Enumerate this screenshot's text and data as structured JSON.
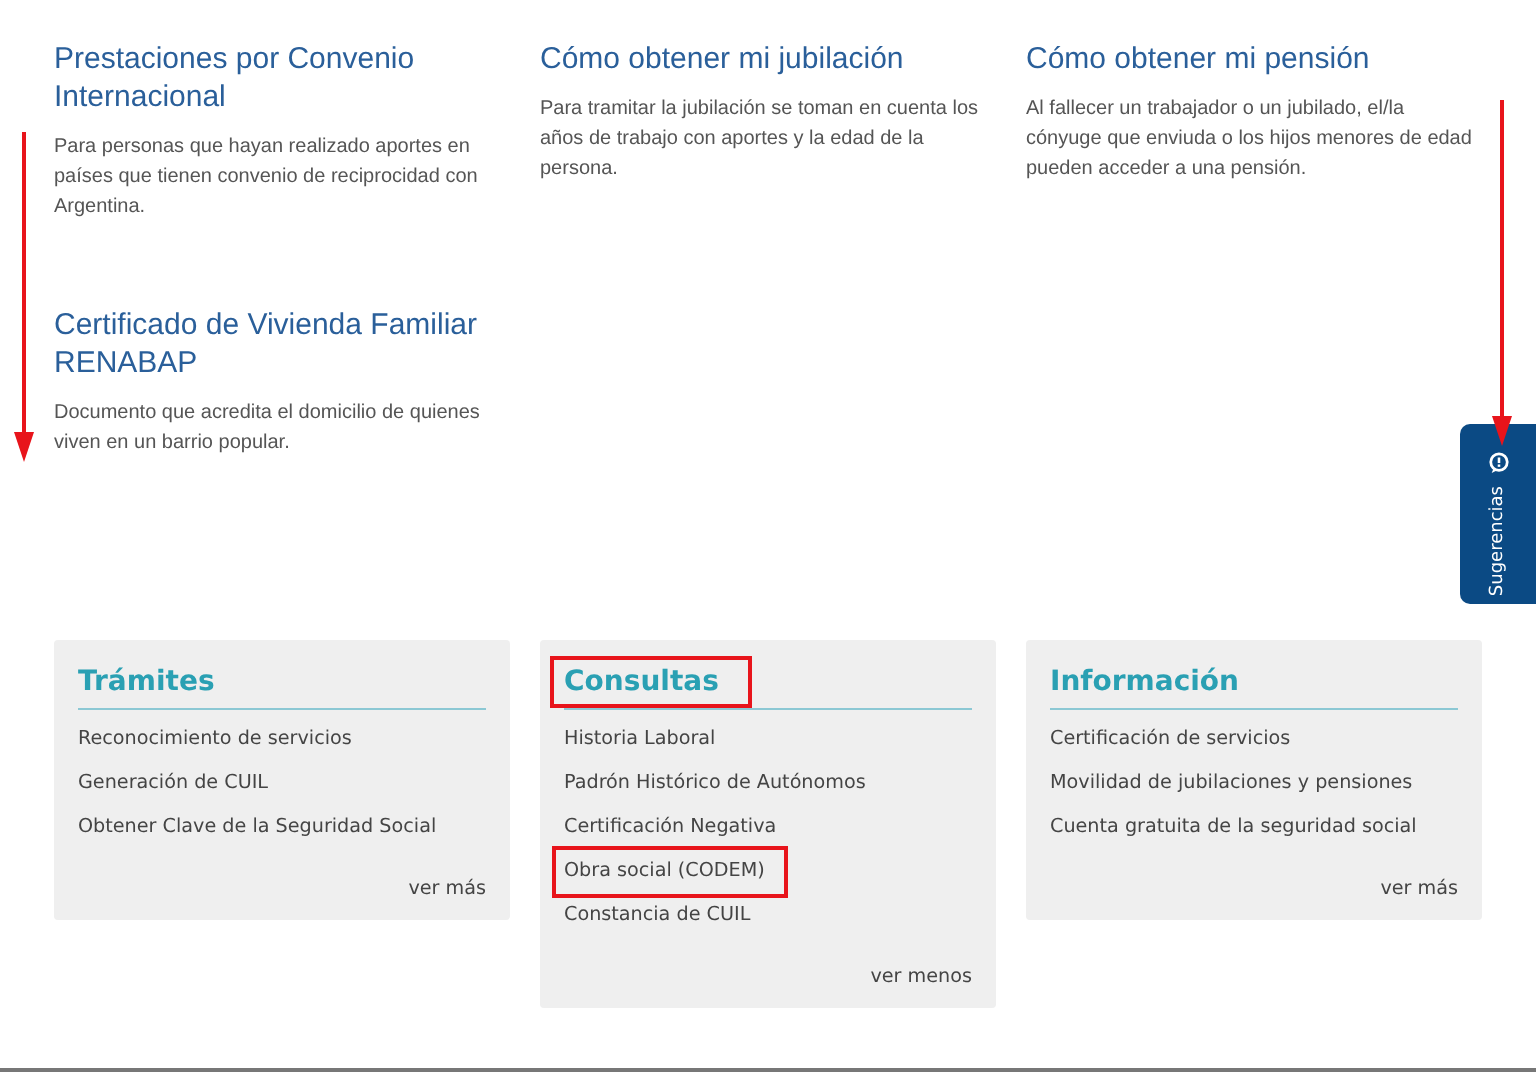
{
  "articles": [
    {
      "title": "Prestaciones por Convenio Internacional",
      "description": "Para personas que hayan realizado aportes en países que tienen convenio de reciprocidad con Argentina."
    },
    {
      "title": "Cómo obtener mi jubilación",
      "description": "Para tramitar la jubilación se toman en cuenta los años de trabajo con aportes y la edad de la persona."
    },
    {
      "title": "Cómo obtener mi pensión",
      "description": "Al fallecer un trabajador o un jubilado, el/la cónyuge que enviuda o los hijos menores de edad pueden acceder a una pensión."
    },
    {
      "title": "Certificado de Vivienda Familiar RENABAP",
      "description": "Documento que acredita el domicilio de quienes viven en un barrio popular."
    }
  ],
  "cards": [
    {
      "title": "Trámites",
      "highlighted": false,
      "items": [
        {
          "label": "Reconocimiento de servicios",
          "highlighted": false
        },
        {
          "label": "Generación de CUIL",
          "highlighted": false
        },
        {
          "label": "Obtener Clave de la Seguridad Social",
          "highlighted": false
        }
      ],
      "more_link": "ver más"
    },
    {
      "title": "Consultas",
      "highlighted": true,
      "items": [
        {
          "label": "Historia Laboral",
          "highlighted": false
        },
        {
          "label": "Padrón Histórico de Autónomos",
          "highlighted": false
        },
        {
          "label": "Certificación Negativa",
          "highlighted": false
        },
        {
          "label": "Obra social (CODEM)",
          "highlighted": true
        },
        {
          "label": "Constancia de CUIL",
          "highlighted": false
        }
      ],
      "more_link": "ver menos"
    },
    {
      "title": "Información",
      "highlighted": false,
      "items": [
        {
          "label": "Certificación de servicios",
          "highlighted": false
        },
        {
          "label": "Movilidad de jubilaciones y pensiones",
          "highlighted": false
        },
        {
          "label": "Cuenta gratuita de la seguridad social",
          "highlighted": false
        }
      ],
      "more_link": "ver más"
    }
  ],
  "feedback_tab": {
    "label": "Sugerencias"
  }
}
